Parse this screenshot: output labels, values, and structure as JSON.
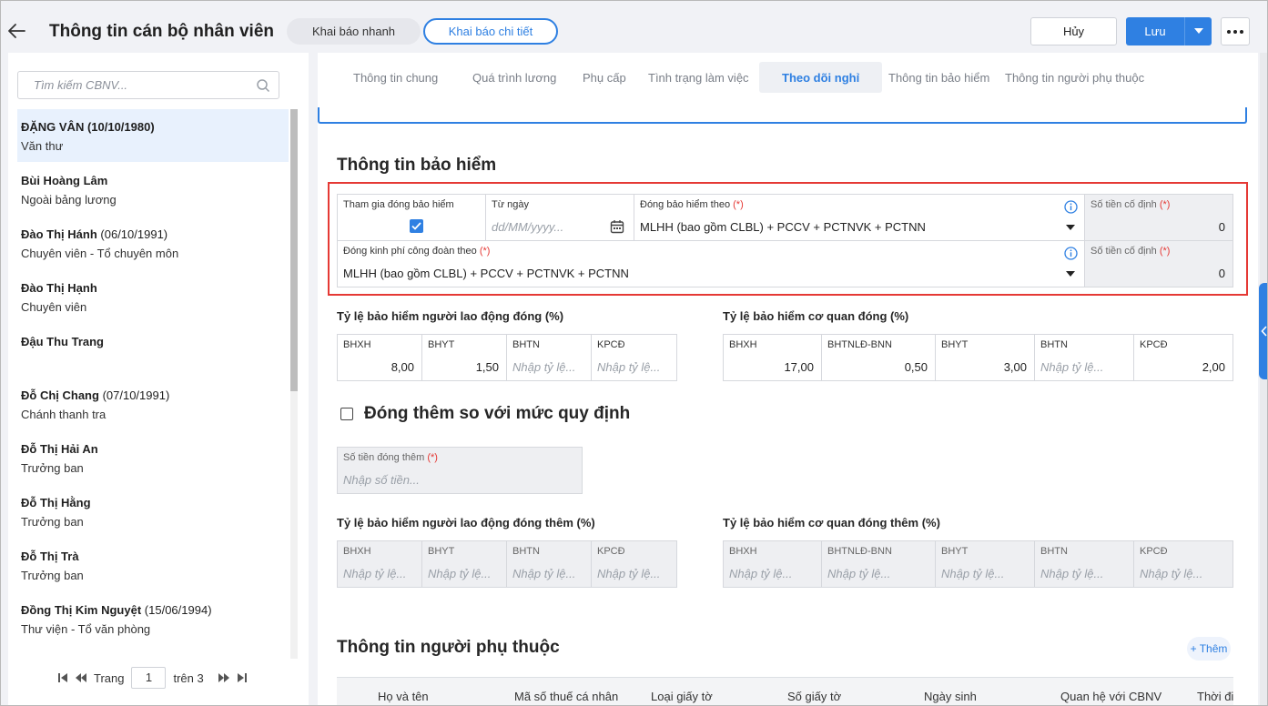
{
  "header": {
    "title": "Thông tin cán bộ nhân viên",
    "mode_quick": "Khai báo nhanh",
    "mode_detail": "Khai báo chi tiết",
    "cancel": "Hủy",
    "save": "Lưu"
  },
  "left": {
    "search_placeholder": "Tìm kiếm CBNV...",
    "employees": [
      {
        "name": "ĐẶNG VÂN (10/10/1980)",
        "dob": "",
        "position": "Văn thư"
      },
      {
        "name": "Bùi Hoàng Lâm",
        "dob": "",
        "position": "Ngoài bảng lương"
      },
      {
        "name": "Đào Thị Hánh",
        "dob": "(06/10/1991)",
        "position": "Chuyên viên - Tổ chuyên môn"
      },
      {
        "name": "Đào Thị Hạnh",
        "dob": "",
        "position": "Chuyên viên"
      },
      {
        "name": "Đậu Thu Trang",
        "dob": "",
        "position": ""
      },
      {
        "name": "Đỗ Chị Chang",
        "dob": "(07/10/1991)",
        "position": "Chánh thanh tra"
      },
      {
        "name": "Đỗ Thị Hải An",
        "dob": "",
        "position": "Trưởng ban"
      },
      {
        "name": "Đỗ Thị Hằng",
        "dob": "",
        "position": "Trưởng ban"
      },
      {
        "name": "Đỗ Thị Trà",
        "dob": "",
        "position": "Trưởng ban"
      },
      {
        "name": "Đồng Thị Kim Nguyệt",
        "dob": "(15/06/1994)",
        "position": "Thư viện - Tổ văn phòng"
      }
    ],
    "pager": {
      "label": "Trang",
      "page": "1",
      "total": "trên 3"
    }
  },
  "tabs": [
    "Thông tin chung",
    "Quá trình lương",
    "Phụ cấp",
    "Tình trạng làm việc",
    "Theo dõi nghỉ",
    "Thông tin bảo hiểm",
    "Thông tin người phụ thuộc"
  ],
  "insurance": {
    "title": "Thông tin bảo hiểm",
    "join_label": "Tham gia đóng bảo hiểm",
    "from_label": "Từ ngày",
    "from_placeholder": "dd/MM/yyyy...",
    "basis_label": "Đóng bảo hiểm theo",
    "basis_value": "MLHH (bao gồm CLBL) + PCCV + PCTNVK + PCTNN",
    "fixed_label": "Số tiền cố định",
    "fixed_value": "0",
    "union_label": "Đóng kinh phí công đoàn theo",
    "union_value": "MLHH (bao gồm CLBL) + PCCV + PCTNVK + PCTNN",
    "fixed2_label": "Số tiền cố định",
    "fixed2_value": "0",
    "req": "(*)"
  },
  "emp_rate": {
    "title": "Tỷ lệ bảo hiểm người lao động đóng (%)",
    "cols": [
      {
        "label": "BHXH",
        "value": "8,00",
        "placeholder": ""
      },
      {
        "label": "BHYT",
        "value": "1,50",
        "placeholder": ""
      },
      {
        "label": "BHTN",
        "value": "",
        "placeholder": "Nhập tỷ lệ..."
      },
      {
        "label": "KPCĐ",
        "value": "",
        "placeholder": "Nhập tỷ lệ..."
      }
    ]
  },
  "org_rate": {
    "title": "Tỷ lệ bảo hiểm cơ quan đóng (%)",
    "cols": [
      {
        "label": "BHXH",
        "value": "17,00",
        "placeholder": ""
      },
      {
        "label": "BHTNLĐ-BNN",
        "value": "0,50",
        "placeholder": ""
      },
      {
        "label": "BHYT",
        "value": "3,00",
        "placeholder": ""
      },
      {
        "label": "BHTN",
        "value": "",
        "placeholder": "Nhập tỷ lệ..."
      },
      {
        "label": "KPCĐ",
        "value": "2,00",
        "placeholder": ""
      }
    ]
  },
  "extra": {
    "title": "Đóng thêm so với mức quy định",
    "amount_label": "Số tiền đóng thêm",
    "amount_placeholder": "Nhập số tiền...",
    "emp_title": "Tỷ lệ bảo hiểm người lao động đóng thêm (%)",
    "org_title": "Tỷ lệ bảo hiểm cơ quan đóng thêm (%)",
    "emp_cols": [
      "BHXH",
      "BHYT",
      "BHTN",
      "KPCĐ"
    ],
    "org_cols": [
      "BHXH",
      "BHTNLĐ-BNN",
      "BHYT",
      "BHTN",
      "KPCĐ"
    ],
    "placeholder": "Nhập tỷ lệ..."
  },
  "dependents": {
    "title": "Thông tin người phụ thuộc",
    "add": "+ Thêm",
    "headers": [
      "Họ và tên",
      "Mã số thuế cá nhân",
      "Loại giấy tờ",
      "Số giấy tờ",
      "Ngày sinh",
      "Quan hệ với CBNV",
      "Thời đi"
    ]
  },
  "colors": {
    "accent": "#2f80e2",
    "required": "#e53935",
    "highlight_box": "#e53935"
  }
}
